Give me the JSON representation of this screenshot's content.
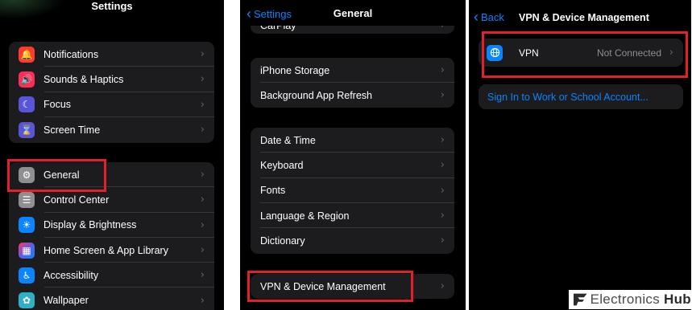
{
  "settings": {
    "title": "Settings",
    "group1": [
      {
        "label": "Notifications",
        "icon": "bell-icon",
        "color": "#ff3b30",
        "glyph": "🔔"
      },
      {
        "label": "Sounds & Haptics",
        "icon": "speaker-icon",
        "color": "#ff2d55",
        "glyph": "🔊"
      },
      {
        "label": "Focus",
        "icon": "moon-icon",
        "color": "#5856d6",
        "glyph": "☾"
      },
      {
        "label": "Screen Time",
        "icon": "hourglass-icon",
        "color": "#5856d6",
        "glyph": "⌛"
      }
    ],
    "group2": [
      {
        "label": "General",
        "icon": "gear-icon",
        "color": "#8e8e93",
        "glyph": "⚙"
      },
      {
        "label": "Control Center",
        "icon": "toggles-icon",
        "color": "#8e8e93",
        "glyph": "☰"
      },
      {
        "label": "Display & Brightness",
        "icon": "sun-icon",
        "color": "#0a84ff",
        "glyph": "☀"
      },
      {
        "label": "Home Screen & App Library",
        "icon": "grid-icon",
        "color": "#5e5ce6",
        "glyph": "▦"
      },
      {
        "label": "Accessibility",
        "icon": "person-icon",
        "color": "#0a84ff",
        "glyph": "♿"
      },
      {
        "label": "Wallpaper",
        "icon": "flower-icon",
        "color": "#30b0c7",
        "glyph": "✿"
      }
    ]
  },
  "general": {
    "back_label": "Settings",
    "title": "General",
    "group0": [
      {
        "label": "CarPlay"
      }
    ],
    "group1": [
      {
        "label": "iPhone Storage"
      },
      {
        "label": "Background App Refresh"
      }
    ],
    "group2": [
      {
        "label": "Date & Time"
      },
      {
        "label": "Keyboard"
      },
      {
        "label": "Fonts"
      },
      {
        "label": "Language & Region"
      },
      {
        "label": "Dictionary"
      }
    ],
    "group3": [
      {
        "label": "VPN & Device Management"
      }
    ]
  },
  "vpn_management": {
    "back_label": "Back",
    "title": "VPN & Device Management",
    "vpn_label": "VPN",
    "vpn_status": "Not Connected",
    "sign_in_link": "Sign In to Work or School Account..."
  },
  "watermark": {
    "brand": "Electronics",
    "brand_bold": "Hub"
  },
  "colors": {
    "highlight": "#e0202a",
    "accent": "#0a84ff",
    "cell": "#1c1c1e"
  }
}
